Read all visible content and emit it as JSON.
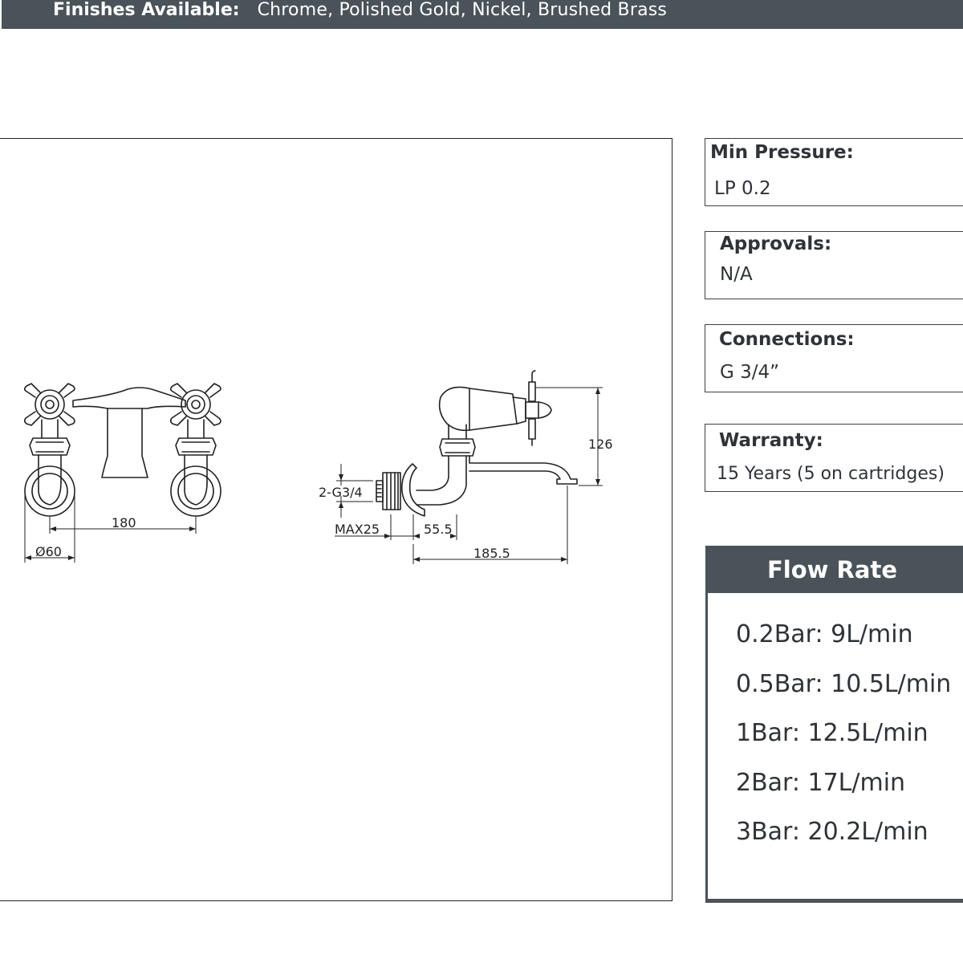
{
  "finishes": {
    "label": "Finishes Available:",
    "value": "Chrome, Polished Gold, Nickel, Brushed Brass"
  },
  "drawing": {
    "dimensions": {
      "spacing": "180",
      "diameter": "Ø60",
      "thread": "2-G3/4",
      "max": "MAX25",
      "offset": "55.5",
      "reach": "185.5",
      "height": "126"
    }
  },
  "specs": {
    "min_pressure": {
      "label": "Min Pressure:",
      "value": "LP 0.2"
    },
    "approvals": {
      "label": "Approvals:",
      "value": "N/A"
    },
    "connections": {
      "label": "Connections:",
      "value": "G 3/4”"
    },
    "warranty": {
      "label": "Warranty:",
      "value": "15 Years (5 on cartridges)"
    }
  },
  "flow_rate": {
    "title": "Flow Rate",
    "items": [
      "0.2Bar: 9L/min",
      "0.5Bar: 10.5L/min",
      "1Bar: 12.5L/min",
      "2Bar: 17L/min",
      "3Bar: 20.2L/min"
    ]
  },
  "colors": {
    "header_bg": "#4a535a",
    "text": "#2f3338",
    "line": "#222222"
  }
}
